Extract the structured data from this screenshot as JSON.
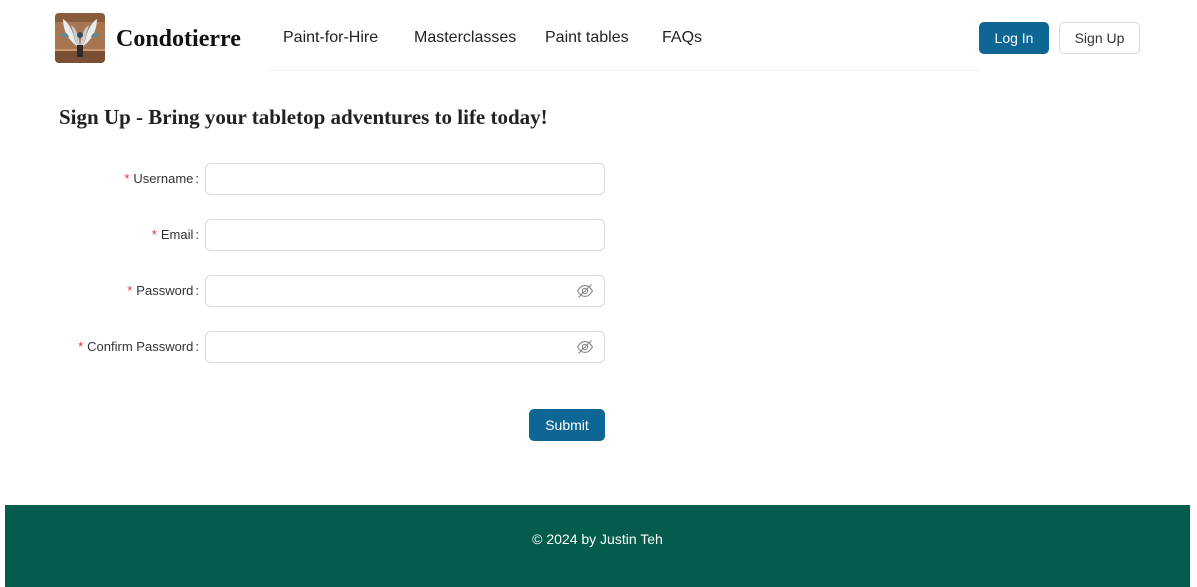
{
  "header": {
    "brand": "Condotierre",
    "nav": [
      "Paint-for-Hire",
      "Masterclasses",
      "Paint tables",
      "FAQs"
    ],
    "login_label": "Log In",
    "signup_label": "Sign Up"
  },
  "main": {
    "title": "Sign Up - Bring your tabletop adventures to life today!",
    "required_mark": "*",
    "fields": [
      {
        "label": "Username",
        "value": "",
        "type": "text"
      },
      {
        "label": "Email",
        "value": "",
        "type": "email"
      },
      {
        "label": "Password",
        "value": "",
        "type": "password",
        "icon": "eye-off-icon"
      },
      {
        "label": "Confirm Password",
        "value": "",
        "type": "password",
        "icon": "eye-off-icon"
      }
    ],
    "submit_label": "Submit"
  },
  "footer": {
    "text": "© 2024 by Justin Teh"
  },
  "colors": {
    "primary": "#0d6694",
    "footer_bg": "#045c4d",
    "required": "#e0353a"
  }
}
